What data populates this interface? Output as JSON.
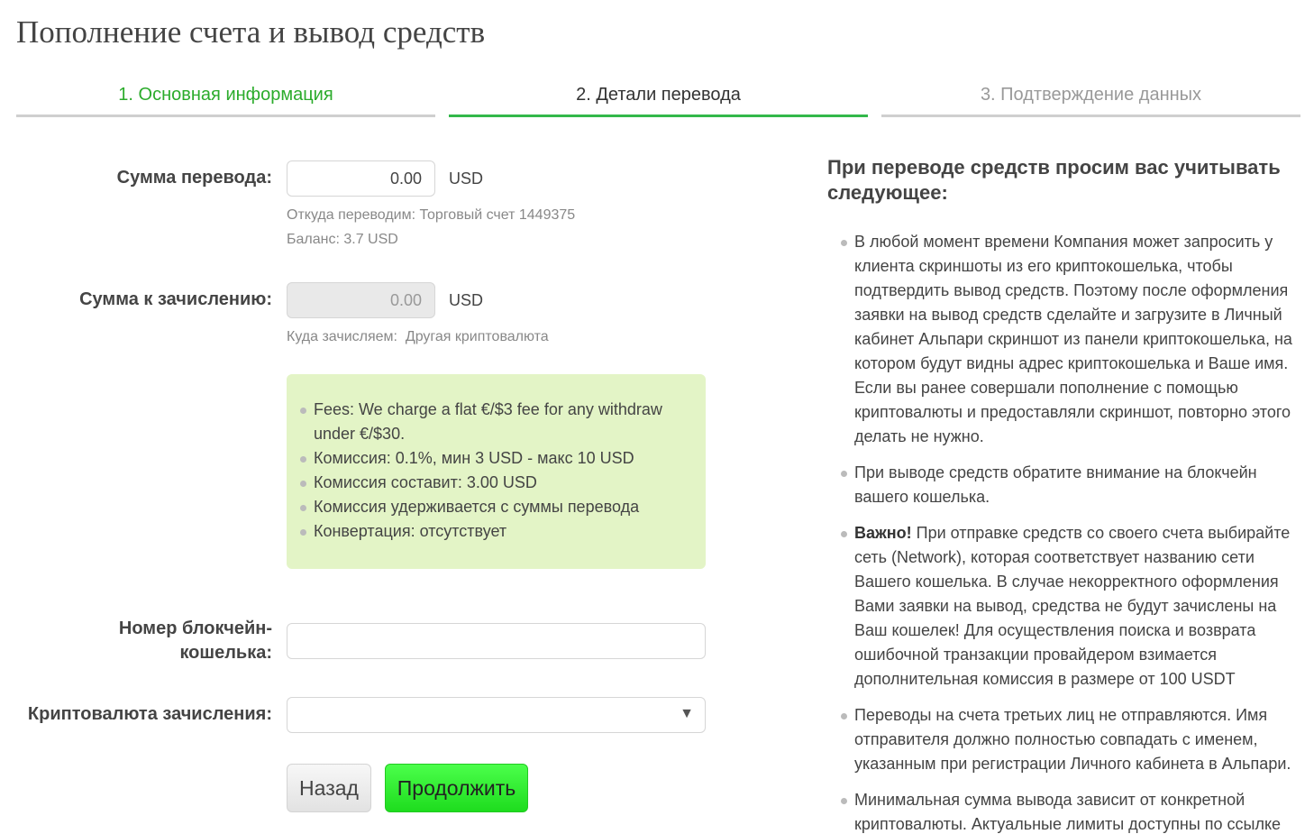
{
  "page": {
    "title": "Пополнение счета и вывод средств"
  },
  "steps": [
    {
      "label": "1. Основная информация",
      "state": "done"
    },
    {
      "label": "2. Детали перевода",
      "state": "active"
    },
    {
      "label": "3. Подтверждение данных",
      "state": "pending"
    }
  ],
  "form": {
    "amount": {
      "label": "Сумма перевода:",
      "value": "0.00",
      "currency": "USD",
      "from_hint": "Откуда переводим: Торговый счет 1449375",
      "balance_hint": "Баланс: 3.7 USD"
    },
    "credit": {
      "label": "Сумма к зачислению:",
      "value": "0.00",
      "currency": "USD",
      "to_hint": "Куда зачисляем:  Другая криптовалюта"
    },
    "fees": [
      "Fees: We charge a flat €/$3 fee for any withdraw under €/$30.",
      "Комиссия: 0.1%, мин 3 USD - макс 10 USD",
      "Комиссия составит: 3.00 USD",
      "Комиссия удерживается с суммы перевода",
      "Конвертация: отсутствует"
    ],
    "wallet": {
      "label_line1": "Номер блокчейн-",
      "label_line2": "кошелька:",
      "value": ""
    },
    "crypto": {
      "label": "Криптовалюта зачисления:",
      "value": "",
      "arrow": "▼"
    },
    "buttons": {
      "back": "Назад",
      "next": "Продолжить"
    }
  },
  "info": {
    "title": "При переводе средств просим вас учитывать следующее:",
    "items": [
      {
        "bold": "",
        "text": "В любой момент времени Компания может запросить у клиента скриншоты из его криптокошелька, чтобы подтвердить вывод средств. Поэтому после оформления заявки на вывод средств сделайте и загрузите в Личный кабинет Альпари скриншот из панели криптокошелька, на котором будут видны адрес криптокошелька и Ваше имя. Если вы ранее совершали пополнение с помощью криптовалюты и предоставляли скриншот, повторно этого делать не нужно."
      },
      {
        "bold": "",
        "text": "При выводе средств обратите внимание на блокчейн вашего кошелька."
      },
      {
        "bold": "Важно!",
        "text": " При отправке средств со своего счета выбирайте сеть (Network), которая соответствует названию сети Вашего кошелька. В случае некорректного оформления Вами заявки на вывод, средства не будут зачислены на Ваш кошелек! Для осуществления поиска и возврата ошибочной транзакции провайдером взимается дополнительная комиссия в размере от 100 USDT"
      },
      {
        "bold": "",
        "text": "Переводы на счета третьих лиц не отправляются. Имя отправителя должно полностью совпадать с именем, указанным при регистрации Личного кабинета в Альпари."
      },
      {
        "bold": "",
        "text": "Минимальная сумма вывода зависит от конкретной криптовалюты. Актуальные лимиты доступны по ссылке"
      }
    ]
  },
  "colors": {
    "accent_green": "#33b84a",
    "done_green": "#2bab2b",
    "fees_bg": "#e3f4c6",
    "next_button": "#1edc1e"
  }
}
